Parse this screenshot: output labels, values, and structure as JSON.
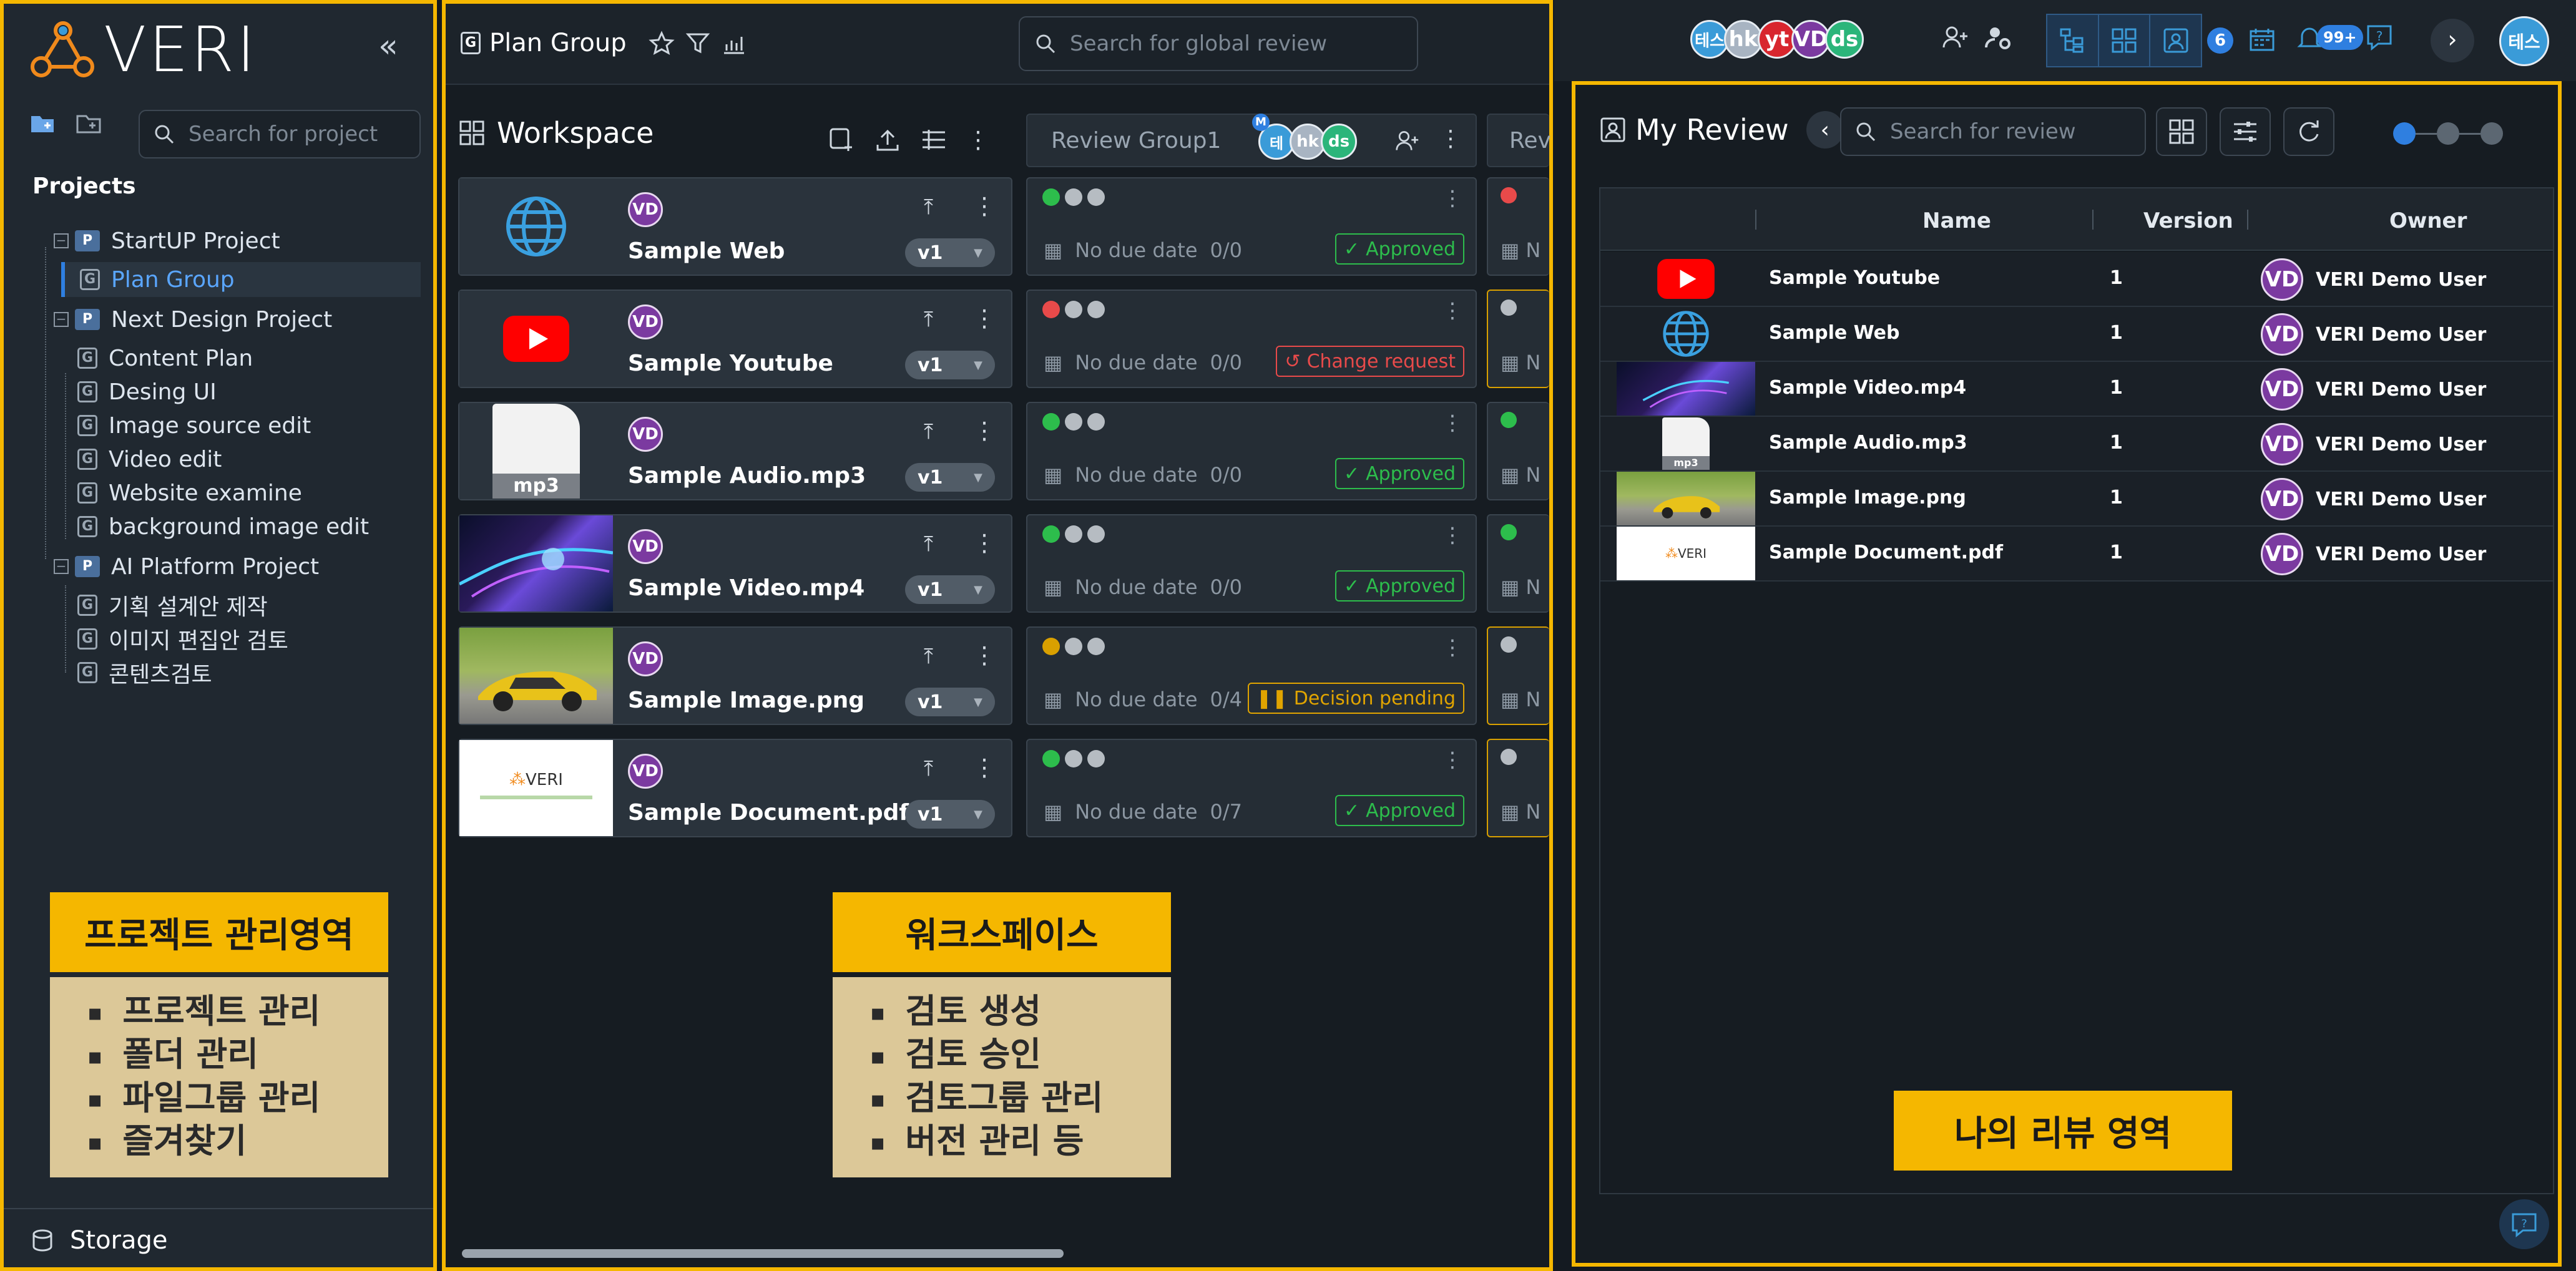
{
  "brand": {
    "name": "VERI"
  },
  "sidebar": {
    "search_placeholder": "Search for project",
    "projects_heading": "Projects",
    "tree": [
      {
        "label": "StartUP Project",
        "type": "project"
      },
      {
        "label": "Plan Group",
        "type": "group",
        "selected": true
      },
      {
        "label": "Next Design Project",
        "type": "project"
      },
      {
        "label": "Content Plan",
        "type": "group"
      },
      {
        "label": "Desing UI",
        "type": "group"
      },
      {
        "label": "Image source edit",
        "type": "group"
      },
      {
        "label": "Video edit",
        "type": "group"
      },
      {
        "label": "Website examine",
        "type": "group"
      },
      {
        "label": "background image edit",
        "type": "group"
      },
      {
        "label": "AI Platform Project",
        "type": "project"
      },
      {
        "label": "기획 설계안 제작",
        "type": "group"
      },
      {
        "label": "이미지 편집안 검토",
        "type": "group"
      },
      {
        "label": "콘텐츠검토",
        "type": "group"
      }
    ],
    "storage_label": "Storage",
    "callout": {
      "title": "프로젝트 관리영역",
      "items": [
        "프로젝트 관리",
        "폴더 관리",
        "파일그룹 관리",
        "즐겨찾기"
      ]
    }
  },
  "workspace": {
    "group_title": "Plan Group",
    "global_search_placeholder": "Search for global review",
    "heading": "Workspace",
    "review_group": "Review Group1",
    "review_group_next": "Rev",
    "assets": [
      {
        "name": "Sample Web",
        "version": "v1",
        "owner": "VD",
        "thumb": "web-globe",
        "due": "No due date",
        "count": "0/0",
        "status": "Approved",
        "status_kind": "approved",
        "dots": [
          "ok",
          "idle",
          "idle"
        ]
      },
      {
        "name": "Sample Youtube",
        "version": "v1",
        "owner": "VD",
        "thumb": "youtube",
        "due": "No due date",
        "count": "0/0",
        "status": "Change request",
        "status_kind": "change",
        "dots": [
          "cr",
          "idle",
          "idle"
        ]
      },
      {
        "name": "Sample Audio.mp3",
        "version": "v1",
        "owner": "VD",
        "thumb": "mp3",
        "due": "No due date",
        "count": "0/0",
        "status": "Approved",
        "status_kind": "approved",
        "dots": [
          "ok",
          "idle",
          "idle"
        ]
      },
      {
        "name": "Sample Video.mp4",
        "version": "v1",
        "owner": "VD",
        "thumb": "video",
        "due": "No due date",
        "count": "0/0",
        "status": "Approved",
        "status_kind": "approved",
        "dots": [
          "ok",
          "idle",
          "idle"
        ]
      },
      {
        "name": "Sample Image.png",
        "version": "v1",
        "owner": "VD",
        "thumb": "image",
        "due": "No due date",
        "count": "0/4",
        "status": "Decision pending",
        "status_kind": "pending",
        "dots": [
          "pe",
          "idle",
          "idle"
        ]
      },
      {
        "name": "Sample Document.pdf",
        "version": "v1",
        "owner": "VD",
        "thumb": "document",
        "due": "No due date",
        "count": "0/7",
        "status": "Approved",
        "status_kind": "approved",
        "dots": [
          "ok",
          "idle",
          "idle"
        ]
      }
    ],
    "mp3_label": "mp3",
    "doc_logo": "VERI",
    "callout": {
      "title": "워크스페이스",
      "items": [
        "검토 생성",
        "검토 승인",
        "검토그룹 관리",
        "버전 관리 등"
      ]
    },
    "group_badge": "M"
  },
  "topbar": {
    "users": [
      {
        "initials": "테스",
        "color": "#3a9bd8"
      },
      {
        "initials": "hk",
        "color": "#a8b4c2"
      },
      {
        "initials": "yt",
        "color": "#d8262e"
      },
      {
        "initials": "VD",
        "color": "#7b3aa0"
      },
      {
        "initials": "ds",
        "color": "#2bb57a"
      }
    ],
    "badge_count": "6",
    "notifications": "99+",
    "me": "테스"
  },
  "my_review": {
    "title": "My Review",
    "search_placeholder": "Search for review",
    "columns": [
      "Name",
      "Version",
      "Owner"
    ],
    "rows": [
      {
        "thumb": "youtube",
        "name": "Sample Youtube",
        "version": "1",
        "owner": "VERI Demo User",
        "initials": "VD"
      },
      {
        "thumb": "web-globe",
        "name": "Sample Web",
        "version": "1",
        "owner": "VERI Demo User",
        "initials": "VD"
      },
      {
        "thumb": "video",
        "name": "Sample Video.mp4",
        "version": "1",
        "owner": "VERI Demo User",
        "initials": "VD"
      },
      {
        "thumb": "mp3",
        "name": "Sample Audio.mp3",
        "version": "1",
        "owner": "VERI Demo User",
        "initials": "VD"
      },
      {
        "thumb": "image",
        "name": "Sample Image.png",
        "version": "1",
        "owner": "VERI Demo User",
        "initials": "VD"
      },
      {
        "thumb": "document",
        "name": "Sample Document.pdf",
        "version": "1",
        "owner": "VERI Demo User",
        "initials": "VD"
      }
    ],
    "callout_title": "나의 리뷰 영역"
  },
  "colors": {
    "accent": "#f5b700",
    "primary": "#2f7fe0",
    "approved": "#2dbd4c",
    "change": "#e84a4a",
    "pending": "#e0a400"
  }
}
